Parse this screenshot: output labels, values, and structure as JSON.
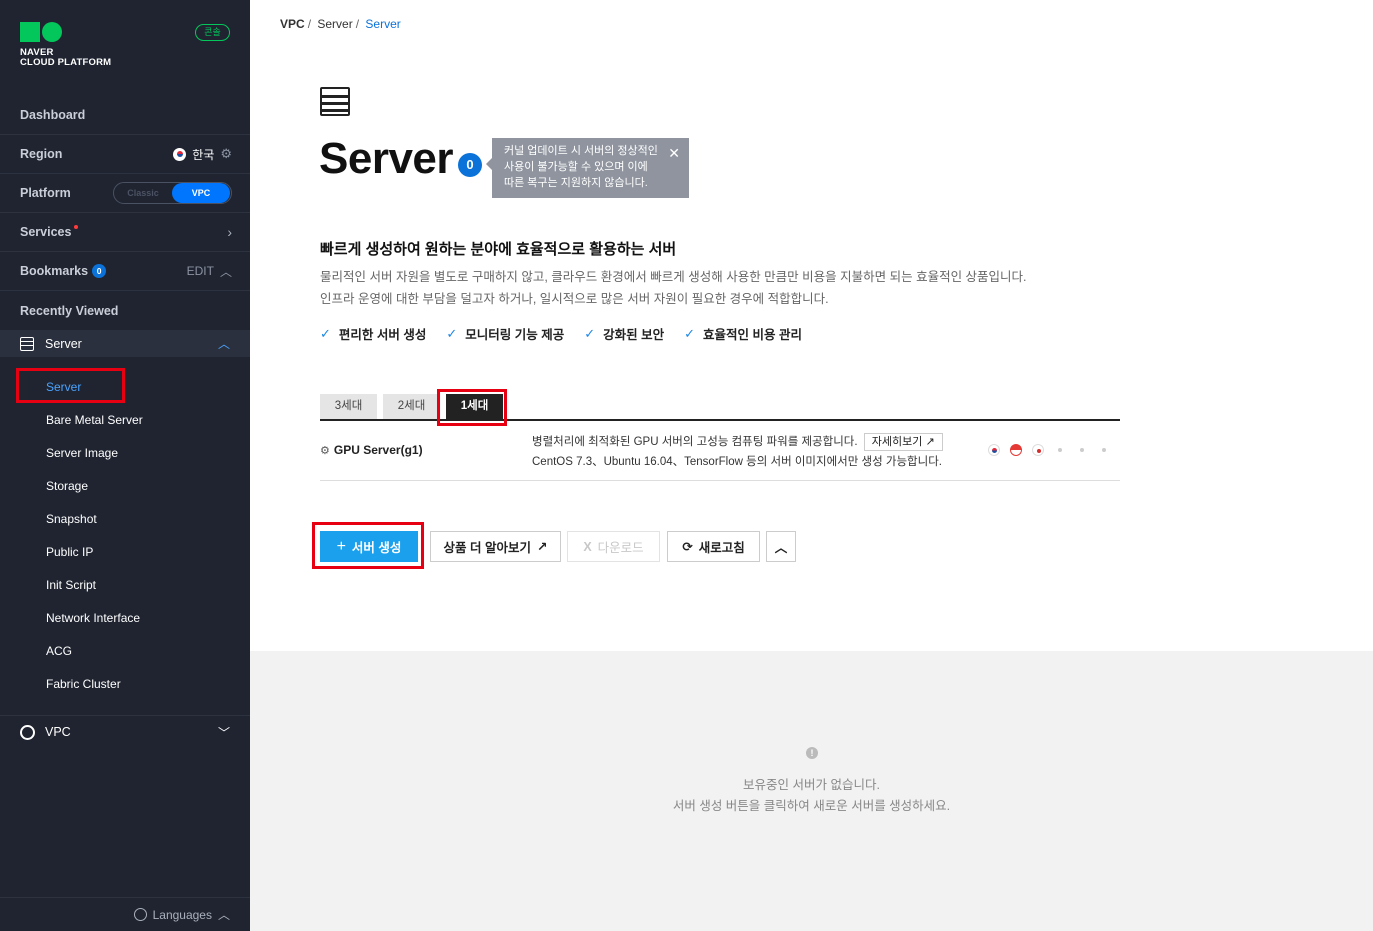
{
  "brand": {
    "line1": "NAVER",
    "line2": "CLOUD PLATFORM",
    "badge": "콘솔"
  },
  "sidebar": {
    "dashboard": "Dashboard",
    "region": {
      "label": "Region",
      "value": "한국"
    },
    "platform": {
      "label": "Platform",
      "options": [
        "Classic",
        "VPC"
      ],
      "selected": "VPC"
    },
    "services": "Services",
    "bookmarks": {
      "label": "Bookmarks",
      "count": "0",
      "edit": "EDIT"
    },
    "recently_viewed": "Recently Viewed",
    "server_group": {
      "label": "Server",
      "items": [
        "Server",
        "Bare Metal Server",
        "Server Image",
        "Storage",
        "Snapshot",
        "Public IP",
        "Init Script",
        "Network Interface",
        "ACG",
        "Fabric Cluster"
      ],
      "active": "Server"
    },
    "vpc_group": "VPC",
    "languages": "Languages"
  },
  "breadcrumb": [
    "VPC",
    "Server",
    "Server"
  ],
  "page": {
    "title": "Server",
    "count": "0",
    "tooltip": [
      "커널 업데이트 시 서버의 정상적인",
      "사용이 불가능할 수 있으며 이에",
      "따른 복구는 지원하지 않습니다."
    ],
    "subtitle": "빠르게 생성하여 원하는 분야에 효율적으로 활용하는 서버",
    "desc1": "물리적인 서버 자원을 별도로 구매하지 않고, 클라우드 환경에서 빠르게 생성해 사용한 만큼만 비용을 지불하면 되는 효율적인 상품입니다.",
    "desc2": "인프라 운영에 대한 부담을 덜고자 하거나, 일시적으로 많은 서버 자원이 필요한 경우에 적합합니다.",
    "features": [
      "편리한 서버 생성",
      "모니터링 기능 제공",
      "강화된 보안",
      "효율적인 비용 관리"
    ]
  },
  "tabs": [
    "3세대",
    "2세대",
    "1세대"
  ],
  "active_tab": "1세대",
  "product": {
    "name": "GPU Server(g1)",
    "desc1": "병렬처리에 최적화된 GPU 서버의 고성능 컴퓨팅 파워를 제공합니다.",
    "more": "자세히보기",
    "desc2": "CentOS 7.3、Ubuntu 16.04、TensorFlow 등의 서버 이미지에서만 생성 가능합니다."
  },
  "actions": {
    "create": "서버 생성",
    "learn_more": "상품 더 알아보기",
    "download": "다운로드",
    "refresh": "새로고침"
  },
  "empty": {
    "line1": "보유중인 서버가 없습니다.",
    "line2": "서버 생성 버튼을 클릭하여 새로운 서버를 생성하세요."
  },
  "colors": {
    "sidebar_bg": "#1f2430",
    "accent": "#0b72d9",
    "primary_button": "#1aa0ec",
    "brand_green": "#03c75a",
    "highlight_box": "#e60012"
  }
}
